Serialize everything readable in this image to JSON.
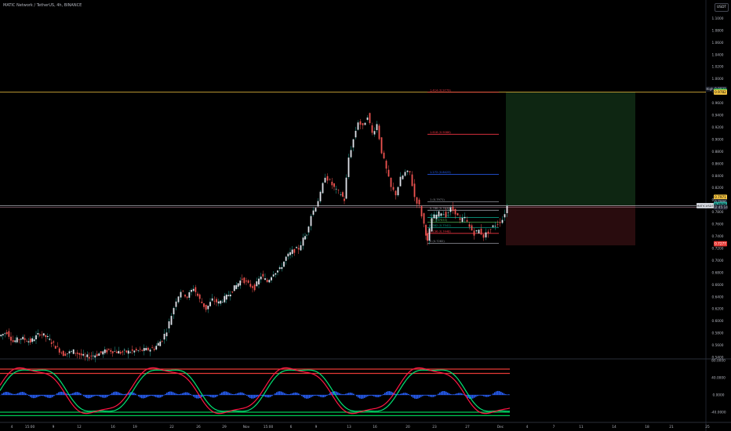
{
  "header": {
    "title": "MATIC Network / TetherUS, 4h, BINANCE",
    "currency_button": "USDT"
  },
  "colors": {
    "up": "#26a69a",
    "down": "#ef5350",
    "gold": "#f5c542",
    "blue": "#2962ff",
    "green": "#00c853",
    "red": "#e53935",
    "bg": "#000000"
  },
  "chart_data": [
    {
      "type": "candlestick",
      "symbol": "MATIC Network / TetherUS, 4h, BINANCE",
      "ylim": [
        0.54,
        1.12
      ],
      "y_ticks": [
        "1.1000",
        "1.0800",
        "1.0600",
        "1.0400",
        "1.0200",
        "1.0000",
        "0.9800",
        "0.9600",
        "0.9400",
        "0.9200",
        "0.9000",
        "0.8800",
        "0.8600",
        "0.8400",
        "0.8200",
        "0.8000",
        "0.7800",
        "0.7600",
        "0.7400",
        "0.7200",
        "0.7000",
        "0.6800",
        "0.6600",
        "0.6400",
        "0.6200",
        "0.6000",
        "0.5800",
        "0.5600",
        "0.5400"
      ],
      "x_ticks": [
        "4",
        "15:00",
        "9",
        "12",
        "16",
        "19",
        "22",
        "26",
        "29",
        "Nov",
        "15:00",
        "6",
        "9",
        "13",
        "16",
        "20",
        "23",
        "27",
        "Dec",
        "4",
        "7",
        "11",
        "14",
        "18",
        "21",
        "25"
      ],
      "price_path": [
        [
          0,
          0.575
        ],
        [
          10,
          0.582
        ],
        [
          18,
          0.566
        ],
        [
          28,
          0.572
        ],
        [
          40,
          0.566
        ],
        [
          52,
          0.58
        ],
        [
          62,
          0.572
        ],
        [
          72,
          0.558
        ],
        [
          82,
          0.545
        ],
        [
          95,
          0.55
        ],
        [
          110,
          0.54
        ],
        [
          125,
          0.545
        ],
        [
          140,
          0.552
        ],
        [
          155,
          0.548
        ],
        [
          170,
          0.55
        ],
        [
          185,
          0.552
        ],
        [
          198,
          0.555
        ],
        [
          208,
          0.57
        ],
        [
          214,
          0.585
        ],
        [
          220,
          0.61
        ],
        [
          226,
          0.635
        ],
        [
          232,
          0.65
        ],
        [
          240,
          0.64
        ],
        [
          248,
          0.655
        ],
        [
          256,
          0.635
        ],
        [
          264,
          0.62
        ],
        [
          272,
          0.635
        ],
        [
          280,
          0.63
        ],
        [
          290,
          0.64
        ],
        [
          300,
          0.655
        ],
        [
          310,
          0.67
        ],
        [
          318,
          0.66
        ],
        [
          326,
          0.655
        ],
        [
          334,
          0.675
        ],
        [
          342,
          0.665
        ],
        [
          350,
          0.68
        ],
        [
          358,
          0.685
        ],
        [
          366,
          0.705
        ],
        [
          374,
          0.715
        ],
        [
          382,
          0.72
        ],
        [
          388,
          0.735
        ],
        [
          392,
          0.745
        ],
        [
          398,
          0.775
        ],
        [
          404,
          0.79
        ],
        [
          410,
          0.81
        ],
        [
          416,
          0.84
        ],
        [
          422,
          0.83
        ],
        [
          430,
          0.815
        ],
        [
          436,
          0.81
        ],
        [
          440,
          0.8
        ],
        [
          446,
          0.87
        ],
        [
          452,
          0.9
        ],
        [
          458,
          0.93
        ],
        [
          464,
          0.92
        ],
        [
          470,
          0.94
        ],
        [
          476,
          0.91
        ],
        [
          482,
          0.925
        ],
        [
          488,
          0.88
        ],
        [
          494,
          0.85
        ],
        [
          500,
          0.82
        ],
        [
          506,
          0.81
        ],
        [
          512,
          0.835
        ],
        [
          518,
          0.845
        ],
        [
          524,
          0.845
        ],
        [
          530,
          0.805
        ],
        [
          536,
          0.79
        ],
        [
          542,
          0.76
        ],
        [
          546,
          0.73
        ],
        [
          552,
          0.77
        ],
        [
          558,
          0.775
        ],
        [
          564,
          0.78
        ],
        [
          570,
          0.775
        ],
        [
          576,
          0.785
        ],
        [
          582,
          0.78
        ],
        [
          588,
          0.765
        ],
        [
          594,
          0.77
        ],
        [
          600,
          0.755
        ],
        [
          606,
          0.745
        ],
        [
          612,
          0.75
        ],
        [
          618,
          0.74
        ],
        [
          624,
          0.748
        ],
        [
          630,
          0.756
        ],
        [
          636,
          0.762
        ],
        [
          642,
          0.768
        ],
        [
          648,
          0.79
        ]
      ],
      "annotations": {
        "fib_labels": [
          "1.414 (0.9779)",
          "1.618 (0.9086)",
          "1.272 (0.8423)",
          "1 (0.7971)",
          "0.786 (0.7830)",
          "0.618 (0.7710)",
          "0.5 (0.7633)",
          "0.382 (0.7541)",
          "0.236 (0.7448)",
          "0 (0.7282)"
        ],
        "fib_levels": [
          0.9779,
          0.9086,
          0.8423,
          0.7971,
          0.783,
          0.771,
          0.7633,
          0.7541,
          0.7448,
          0.7282
        ],
        "horizontal_line": 0.9782,
        "current_line": 0.7906,
        "position_entry": 0.791,
        "position_target": 0.978,
        "position_stop": 0.725
      },
      "price_labels": {
        "high_tag": "High",
        "high_value": "0.9831",
        "line_value": "0.9782",
        "price_a": "0.7971",
        "price_b": "0.7906",
        "current": "0.7926",
        "symbol_tag": "MATICUSDT",
        "stop": "0.7277",
        "line_price_green": "0.9784",
        "countdown": "02:45:14"
      }
    },
    {
      "type": "line",
      "name_hidden": true,
      "ylim": [
        -60,
        80
      ],
      "y_ticks": [
        "80.0000",
        "40.0000",
        "0.0000",
        "-40.0000"
      ],
      "levels": [
        60,
        50,
        -40,
        -48
      ]
    }
  ]
}
